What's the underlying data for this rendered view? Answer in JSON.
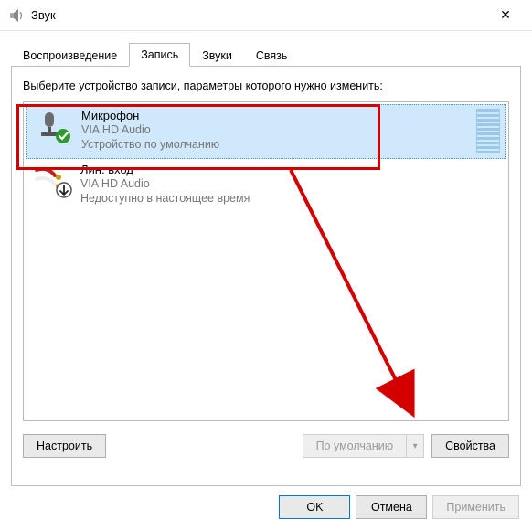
{
  "window": {
    "title": "Звук"
  },
  "tabs": {
    "items": [
      {
        "label": "Воспроизведение"
      },
      {
        "label": "Запись"
      },
      {
        "label": "Звуки"
      },
      {
        "label": "Связь"
      }
    ],
    "active_index": 1
  },
  "panel": {
    "instruction": "Выберите устройство записи, параметры которого нужно изменить:",
    "devices": [
      {
        "name": "Микрофон",
        "driver": "VIA HD Audio",
        "status": "Устройство по умолчанию",
        "selected": true,
        "state": "default"
      },
      {
        "name": "Лин. вход",
        "driver": "VIA HD Audio",
        "status": "Недоступно в настоящее время",
        "selected": false,
        "state": "disabled"
      }
    ],
    "configure_label": "Настроить",
    "default_label": "По умолчанию",
    "properties_label": "Свойства"
  },
  "dialog_buttons": {
    "ok": "OK",
    "cancel": "Отмена",
    "apply": "Применить"
  }
}
